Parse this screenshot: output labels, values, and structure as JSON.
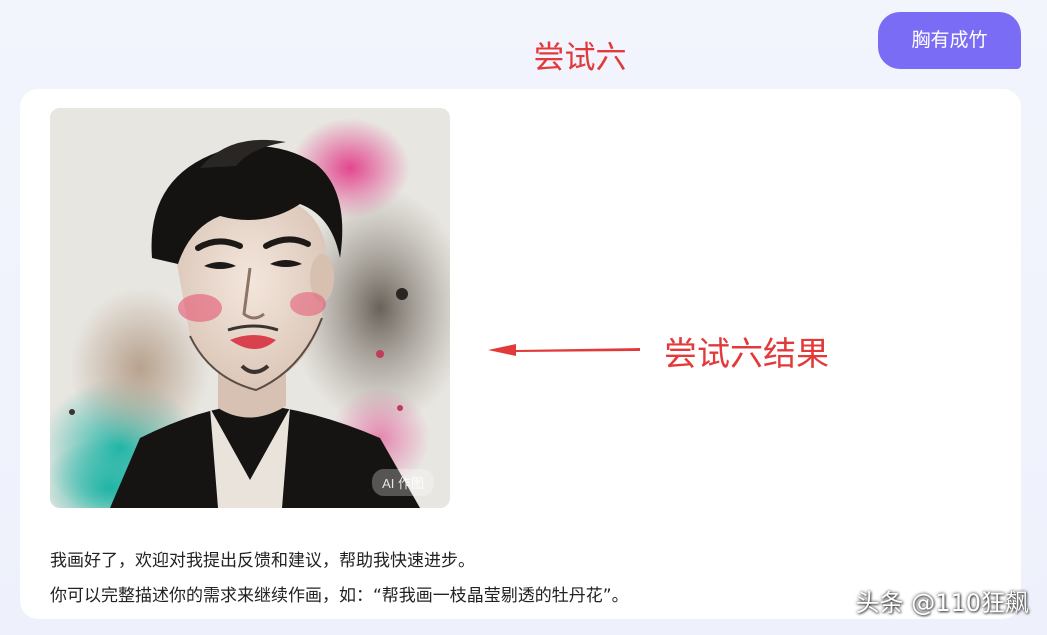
{
  "user_message": {
    "text": "胸有成竹"
  },
  "annotations": {
    "title": "尝试六",
    "result_label": "尝试六结果",
    "color": "#e23a3a"
  },
  "ai_reply": {
    "image_alt": "ink-wash style portrait of a young man",
    "image_badge": "AI 作图",
    "line1": "我画好了，欢迎对我提出反馈和建议，帮助我快速进步。",
    "line2": "你可以完整描述你的需求来继续作画，如：“帮我画一枝晶莹剔透的牡丹花”。"
  },
  "watermark": {
    "text": "头条 @110狂飙"
  },
  "colors": {
    "accent": "#7b6cf6",
    "annotation": "#e23a3a",
    "card": "#ffffff",
    "background": "#eef1fb"
  }
}
